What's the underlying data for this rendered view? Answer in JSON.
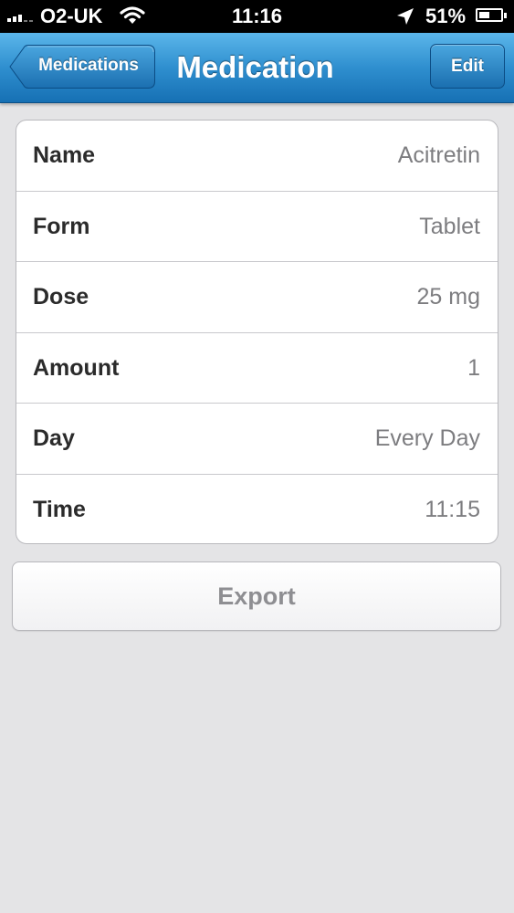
{
  "status_bar": {
    "carrier": "O2-UK",
    "time": "11:16",
    "battery_percent": "51%",
    "battery_level": 0.51,
    "signal_bars": 3,
    "icons": [
      "signal-bars-icon",
      "wifi-icon",
      "location-arrow-icon",
      "battery-icon"
    ]
  },
  "nav": {
    "title": "Medication",
    "back_label": "Medications",
    "edit_label": "Edit"
  },
  "details": [
    {
      "label": "Name",
      "value": "Acitretin"
    },
    {
      "label": "Form",
      "value": "Tablet"
    },
    {
      "label": "Dose",
      "value": "25 mg"
    },
    {
      "label": "Amount",
      "value": "1"
    },
    {
      "label": "Day",
      "value": "Every Day"
    },
    {
      "label": "Time",
      "value": "11:15"
    }
  ],
  "export_label": "Export",
  "colors": {
    "nav_bar": "#2f8fcf",
    "background": "#e4e4e6",
    "label_text": "#2b2b2b",
    "value_text": "#7d7d80",
    "export_text": "#8e8e92"
  }
}
